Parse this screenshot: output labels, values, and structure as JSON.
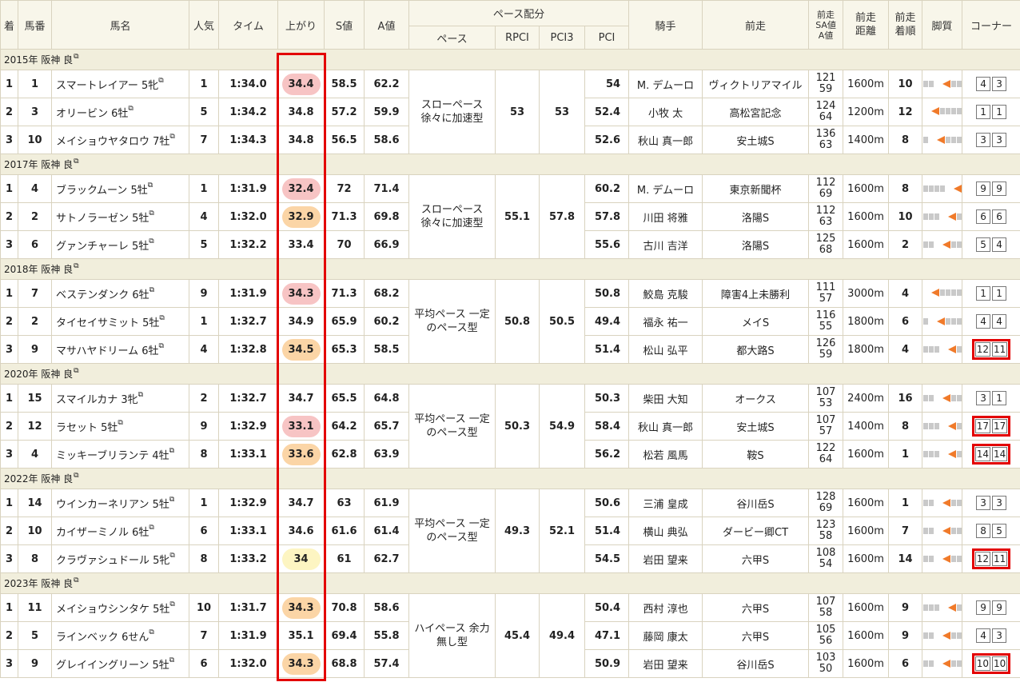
{
  "header": {
    "rank": "着",
    "horse_no": "馬番",
    "horse_name": "馬名",
    "popularity": "人気",
    "time": "タイム",
    "last3f": "上がり",
    "s_value": "S値",
    "a_value": "A値",
    "pace_group": "ペース配分",
    "pace": "ペース",
    "rpci": "RPCI",
    "pci3": "PCI3",
    "pci": "PCI",
    "jockey": "騎手",
    "prev_race": "前走",
    "prev_sa_1": "前走",
    "prev_sa_2": "SA値",
    "prev_sa_3": "A値",
    "prev_dist_1": "前走",
    "prev_dist_2": "距離",
    "prev_rank_1": "前走",
    "prev_rank_2": "着順",
    "legs": "脚質",
    "corner": "コーナー"
  },
  "sections": [
    {
      "title": "2015年 阪神 良",
      "pace": "スローペース 徐々に加速型",
      "rpci": "53",
      "pci3": "53",
      "rows": [
        {
          "rank": "1",
          "no": "1",
          "name": "スマートレイアー 5牝",
          "pop": "1",
          "time": "1:34.0",
          "last3f": "34.4",
          "hl": "pink",
          "s": "58.5",
          "a": "62.2",
          "pci": "54",
          "jockey": "M. デムーロ",
          "prev": "ヴィクトリアマイル",
          "sa1": "121",
          "sa2": "59",
          "dist": "1600m",
          "prank": "10",
          "legs": 2,
          "corner": [
            "4",
            "3"
          ],
          "mark": false
        },
        {
          "rank": "2",
          "no": "3",
          "name": "オリービン 6牡",
          "pop": "5",
          "time": "1:34.2",
          "last3f": "34.8",
          "hl": "",
          "s": "57.2",
          "a": "59.9",
          "pci": "52.4",
          "jockey": "小牧 太",
          "prev": "高松宮記念",
          "sa1": "124",
          "sa2": "64",
          "dist": "1200m",
          "prank": "12",
          "legs": 0,
          "corner": [
            "1",
            "1"
          ],
          "mark": false
        },
        {
          "rank": "3",
          "no": "10",
          "name": "メイショウヤタロウ 7牡",
          "pop": "7",
          "time": "1:34.3",
          "last3f": "34.8",
          "hl": "",
          "s": "56.5",
          "a": "58.6",
          "pci": "52.6",
          "jockey": "秋山 真一郎",
          "prev": "安土城S",
          "sa1": "136",
          "sa2": "63",
          "dist": "1400m",
          "prank": "8",
          "legs": 1,
          "corner": [
            "3",
            "3"
          ],
          "mark": false
        }
      ]
    },
    {
      "title": "2017年 阪神 良",
      "pace": "スローペース 徐々に加速型",
      "rpci": "55.1",
      "pci3": "57.8",
      "rows": [
        {
          "rank": "1",
          "no": "4",
          "name": "ブラックムーン 5牡",
          "pop": "1",
          "time": "1:31.9",
          "last3f": "32.4",
          "hl": "pink",
          "s": "72",
          "a": "71.4",
          "pci": "60.2",
          "jockey": "M. デムーロ",
          "prev": "東京新聞杯",
          "sa1": "112",
          "sa2": "69",
          "dist": "1600m",
          "prank": "8",
          "legs": 4,
          "corner": [
            "9",
            "9"
          ],
          "mark": false
        },
        {
          "rank": "2",
          "no": "2",
          "name": "サトノラーゼン 5牡",
          "pop": "4",
          "time": "1:32.0",
          "last3f": "32.9",
          "hl": "orange",
          "s": "71.3",
          "a": "69.8",
          "pci": "57.8",
          "jockey": "川田 将雅",
          "prev": "洛陽S",
          "sa1": "112",
          "sa2": "63",
          "dist": "1600m",
          "prank": "10",
          "legs": 3,
          "corner": [
            "6",
            "6"
          ],
          "mark": false
        },
        {
          "rank": "3",
          "no": "6",
          "name": "グァンチャーレ 5牡",
          "pop": "5",
          "time": "1:32.2",
          "last3f": "33.4",
          "hl": "",
          "s": "70",
          "a": "66.9",
          "pci": "55.6",
          "jockey": "古川 吉洋",
          "prev": "洛陽S",
          "sa1": "125",
          "sa2": "68",
          "dist": "1600m",
          "prank": "2",
          "legs": 2,
          "corner": [
            "5",
            "4"
          ],
          "mark": false
        }
      ]
    },
    {
      "title": "2018年 阪神 良",
      "pace": "平均ペース 一定のペース型",
      "rpci": "50.8",
      "pci3": "50.5",
      "rows": [
        {
          "rank": "1",
          "no": "7",
          "name": "ベステンダンク 6牡",
          "pop": "9",
          "time": "1:31.9",
          "last3f": "34.3",
          "hl": "pink",
          "s": "71.3",
          "a": "68.2",
          "pci": "50.8",
          "jockey": "鮫島 克駿",
          "prev": "障害4上未勝利",
          "sa1": "111",
          "sa2": "57",
          "dist": "3000m",
          "prank": "4",
          "legs": 0,
          "corner": [
            "1",
            "1"
          ],
          "mark": false
        },
        {
          "rank": "2",
          "no": "2",
          "name": "タイセイサミット 5牡",
          "pop": "1",
          "time": "1:32.7",
          "last3f": "34.9",
          "hl": "",
          "s": "65.9",
          "a": "60.2",
          "pci": "49.4",
          "jockey": "福永 祐一",
          "prev": "メイS",
          "sa1": "116",
          "sa2": "55",
          "dist": "1800m",
          "prank": "6",
          "legs": 1,
          "corner": [
            "4",
            "4"
          ],
          "mark": false
        },
        {
          "rank": "3",
          "no": "9",
          "name": "マサハヤドリーム 6牡",
          "pop": "4",
          "time": "1:32.8",
          "last3f": "34.5",
          "hl": "orange",
          "s": "65.3",
          "a": "58.5",
          "pci": "51.4",
          "jockey": "松山 弘平",
          "prev": "都大路S",
          "sa1": "126",
          "sa2": "59",
          "dist": "1800m",
          "prank": "4",
          "legs": 3,
          "corner": [
            "12",
            "11"
          ],
          "mark": true
        }
      ]
    },
    {
      "title": "2020年 阪神 良",
      "pace": "平均ペース 一定のペース型",
      "rpci": "50.3",
      "pci3": "54.9",
      "rows": [
        {
          "rank": "1",
          "no": "15",
          "name": "スマイルカナ 3牝",
          "pop": "2",
          "time": "1:32.7",
          "last3f": "34.7",
          "hl": "",
          "s": "65.5",
          "a": "64.8",
          "pci": "50.3",
          "jockey": "柴田 大知",
          "prev": "オークス",
          "sa1": "107",
          "sa2": "53",
          "dist": "2400m",
          "prank": "16",
          "legs": 2,
          "corner": [
            "3",
            "1"
          ],
          "mark": false
        },
        {
          "rank": "2",
          "no": "12",
          "name": "ラセット 5牡",
          "pop": "9",
          "time": "1:32.9",
          "last3f": "33.1",
          "hl": "pink",
          "s": "64.2",
          "a": "65.7",
          "pci": "58.4",
          "jockey": "秋山 真一郎",
          "prev": "安土城S",
          "sa1": "107",
          "sa2": "57",
          "dist": "1400m",
          "prank": "8",
          "legs": 3,
          "corner": [
            "17",
            "17"
          ],
          "mark": true
        },
        {
          "rank": "3",
          "no": "4",
          "name": "ミッキーブリランテ 4牡",
          "pop": "8",
          "time": "1:33.1",
          "last3f": "33.6",
          "hl": "orange",
          "s": "62.8",
          "a": "63.9",
          "pci": "56.2",
          "jockey": "松若 風馬",
          "prev": "鞍S",
          "sa1": "122",
          "sa2": "64",
          "dist": "1600m",
          "prank": "1",
          "legs": 3,
          "corner": [
            "14",
            "14"
          ],
          "mark": true
        }
      ]
    },
    {
      "title": "2022年 阪神 良",
      "pace": "平均ペース 一定のペース型",
      "rpci": "49.3",
      "pci3": "52.1",
      "rows": [
        {
          "rank": "1",
          "no": "14",
          "name": "ウインカーネリアン 5牡",
          "pop": "1",
          "time": "1:32.9",
          "last3f": "34.7",
          "hl": "",
          "s": "63",
          "a": "61.9",
          "pci": "50.6",
          "jockey": "三浦 皇成",
          "prev": "谷川岳S",
          "sa1": "128",
          "sa2": "69",
          "dist": "1600m",
          "prank": "1",
          "legs": 2,
          "corner": [
            "3",
            "3"
          ],
          "mark": false
        },
        {
          "rank": "2",
          "no": "10",
          "name": "カイザーミノル 6牡",
          "pop": "6",
          "time": "1:33.1",
          "last3f": "34.6",
          "hl": "",
          "s": "61.6",
          "a": "61.4",
          "pci": "51.4",
          "jockey": "横山 典弘",
          "prev": "ダービー卿CT",
          "sa1": "123",
          "sa2": "58",
          "dist": "1600m",
          "prank": "7",
          "legs": 2,
          "corner": [
            "8",
            "5"
          ],
          "mark": false
        },
        {
          "rank": "3",
          "no": "8",
          "name": "クラヴァシュドール 5牝",
          "pop": "8",
          "time": "1:33.2",
          "last3f": "34",
          "hl": "yellow",
          "s": "61",
          "a": "62.7",
          "pci": "54.5",
          "jockey": "岩田 望来",
          "prev": "六甲S",
          "sa1": "108",
          "sa2": "54",
          "dist": "1600m",
          "prank": "14",
          "legs": 2,
          "corner": [
            "12",
            "11"
          ],
          "mark": true
        }
      ]
    },
    {
      "title": "2023年 阪神 良",
      "pace": "ハイペース 余力無し型",
      "rpci": "45.4",
      "pci3": "49.4",
      "rows": [
        {
          "rank": "1",
          "no": "11",
          "name": "メイショウシンタケ 5牡",
          "pop": "10",
          "time": "1:31.7",
          "last3f": "34.3",
          "hl": "orange",
          "s": "70.8",
          "a": "58.6",
          "pci": "50.4",
          "jockey": "西村 淳也",
          "prev": "六甲S",
          "sa1": "107",
          "sa2": "58",
          "dist": "1600m",
          "prank": "9",
          "legs": 3,
          "corner": [
            "9",
            "9"
          ],
          "mark": false
        },
        {
          "rank": "2",
          "no": "5",
          "name": "ラインベック 6せん",
          "pop": "7",
          "time": "1:31.9",
          "last3f": "35.1",
          "hl": "",
          "s": "69.4",
          "a": "55.8",
          "pci": "47.1",
          "jockey": "藤岡 康太",
          "prev": "六甲S",
          "sa1": "105",
          "sa2": "56",
          "dist": "1600m",
          "prank": "9",
          "legs": 2,
          "corner": [
            "4",
            "3"
          ],
          "mark": false
        },
        {
          "rank": "3",
          "no": "9",
          "name": "グレイイングリーン 5牡",
          "pop": "6",
          "time": "1:32.0",
          "last3f": "34.3",
          "hl": "orange",
          "s": "68.8",
          "a": "57.4",
          "pci": "50.9",
          "jockey": "岩田 望来",
          "prev": "谷川岳S",
          "sa1": "103",
          "sa2": "50",
          "dist": "1600m",
          "prank": "6",
          "legs": 2,
          "corner": [
            "10",
            "10"
          ],
          "mark": true
        }
      ]
    }
  ],
  "colors": {
    "accent_red": "#e30000",
    "pink": "#f7c4c4",
    "orange": "#fbd5a6",
    "yellow": "#fdf5c2",
    "legs_orange": "#f07a2a"
  },
  "icons": {
    "external_link": "external-link-icon",
    "legs_arrow": "running-style-arrow-icon"
  }
}
